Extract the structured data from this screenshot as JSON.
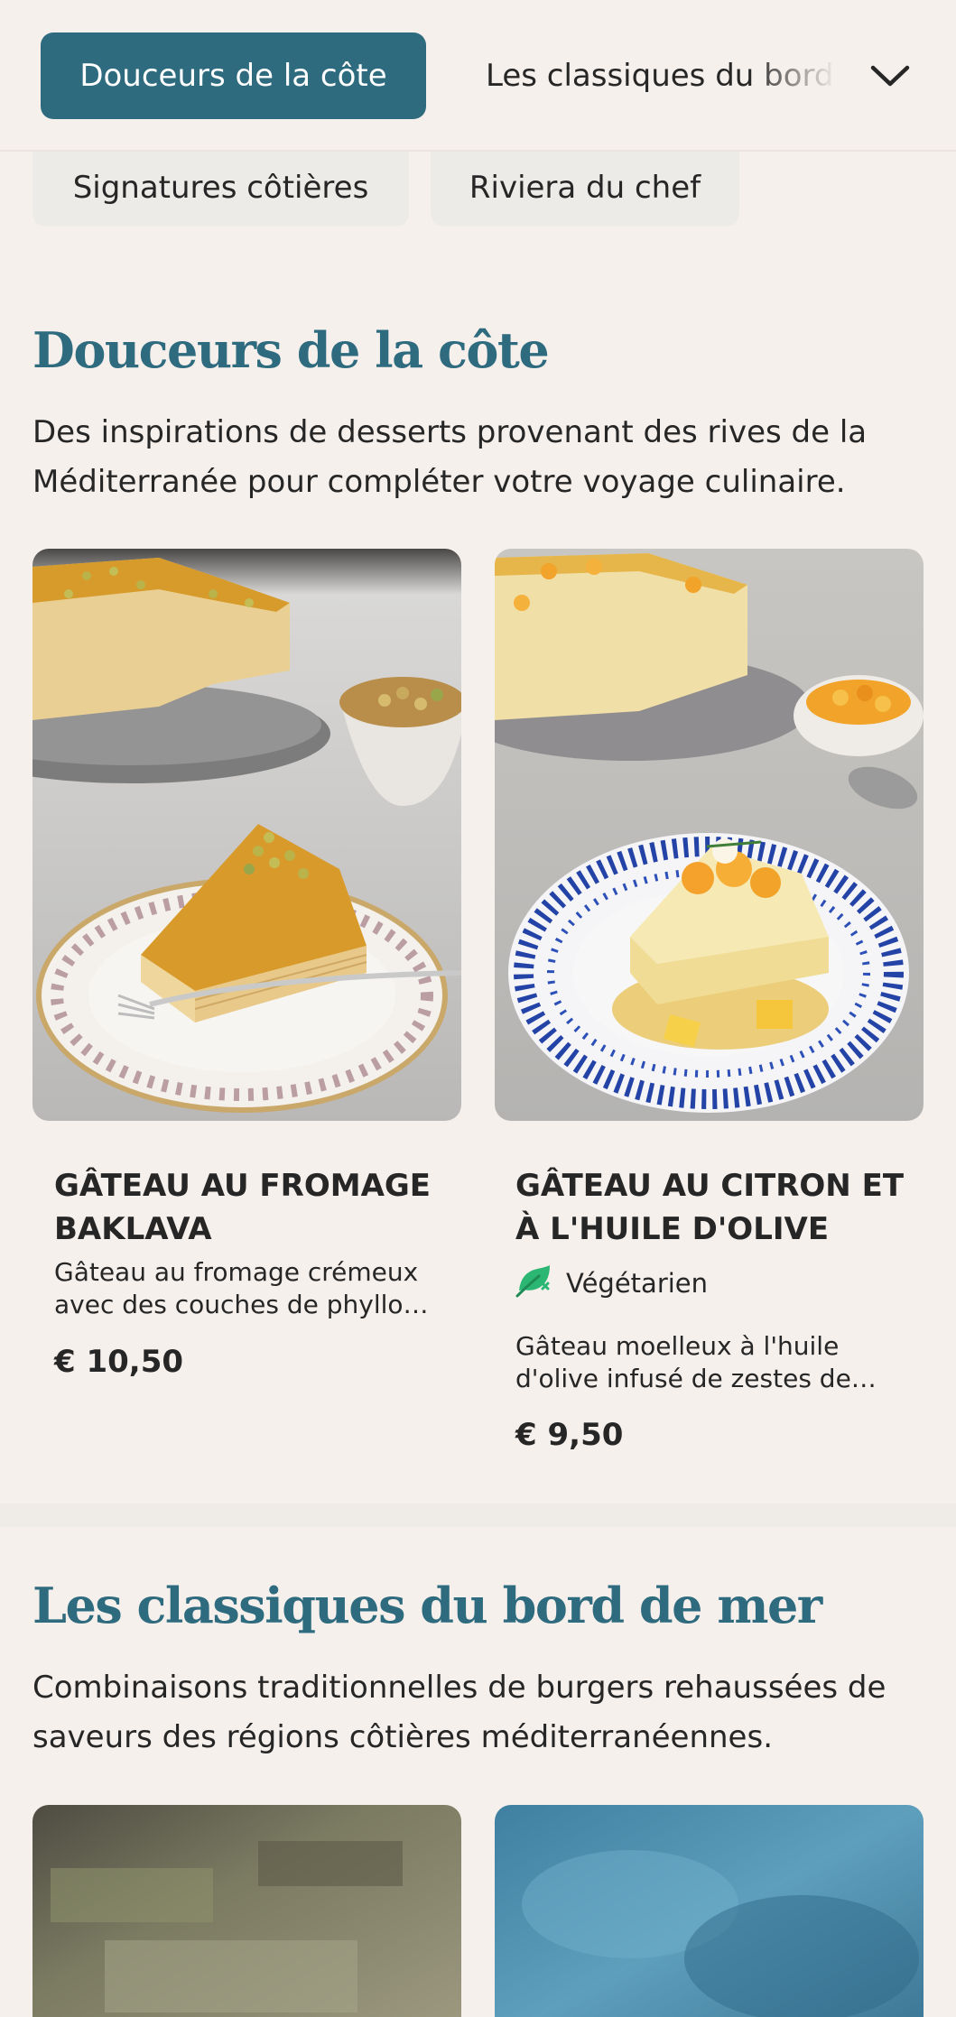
{
  "tabs": {
    "active_label": "Douceurs de la côte",
    "next_label": "Les classiques du bord de mer",
    "chips": [
      "Signatures côtières",
      "Riviera du chef"
    ]
  },
  "section_desserts": {
    "title": "Douceurs de la côte",
    "description": "Des inspirations de desserts provenant des rives de la Méditerranée pour compléter votre voyage culinaire.",
    "items": [
      {
        "name": "GÂTEAU AU FROMAGE BAKLAVA",
        "description": "Gâteau au fromage crémeux avec des couches de phyllo…",
        "price": "€ 10,50"
      },
      {
        "name": "GÂTEAU AU CITRON ET À L'HUILE D'OLIVE",
        "tag": "Végétarien",
        "tag_icon": "vegetarian-icon",
        "description": "Gâteau moelleux à l'huile d'olive infusé de zestes de…",
        "price": "€ 9,50"
      }
    ]
  },
  "section_classics": {
    "title": "Les classiques du bord de mer",
    "description": "Combinaisons traditionnelles de burgers rehaussées de saveurs des régions côtières méditerranéennes."
  },
  "colors": {
    "accent": "#2f6b7f",
    "background": "#f6f0ec",
    "veg_green": "#2bb673"
  },
  "icons": {
    "dropdown": "chevron-down-icon"
  }
}
